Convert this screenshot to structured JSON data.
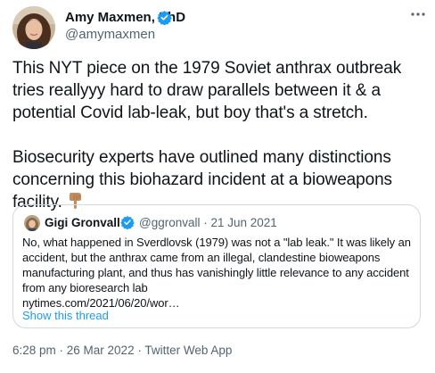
{
  "colors": {
    "text": "#0f1419",
    "secondary": "#536471",
    "link": "#1d9bf0",
    "verified": "#1d9bf0",
    "border": "#cfd9de"
  },
  "author": {
    "name": "Amy Maxmen, PhD",
    "handle": "@amymaxmen",
    "verified_icon": "verified-badge-icon",
    "avatar_icon": "profile-photo"
  },
  "more_icon": "more-options-icon",
  "tweet": {
    "paragraph1": [
      "This NYT piece on the 1979 Soviet anthrax outbreak",
      "tries reallyyy hard to draw parallels between it & a",
      "potential Covid lab-leak, but boy that's a stretch."
    ],
    "paragraph2": [
      "Biosecurity experts have outlined many distinctions",
      "concerning this biohazard incident at a bioweapons",
      "facility."
    ],
    "emoji": "backhand-index-pointing-down"
  },
  "quote": {
    "name": "Gigi Gronvall",
    "handle": "@ggronvall",
    "separator": "·",
    "date": "21 Jun 2021",
    "meta": "@ggronvall · 21 Jun 2021",
    "lines": [
      "No, what happened in Sverdlovsk (1979) was not a \"lab leak.\" It was likely an",
      "accident, but the anthrax came from an illegal, clandestine bioweapons",
      "manufacturing plant, and thus has vanishingly little relevance to any accident",
      "from any bioresearch lab",
      "nytimes.com/2021/06/20/wor…"
    ],
    "show_thread": "Show this thread"
  },
  "footer": {
    "timestamp": "6:28 pm · 26 Mar 2022 · Twitter Web App"
  }
}
